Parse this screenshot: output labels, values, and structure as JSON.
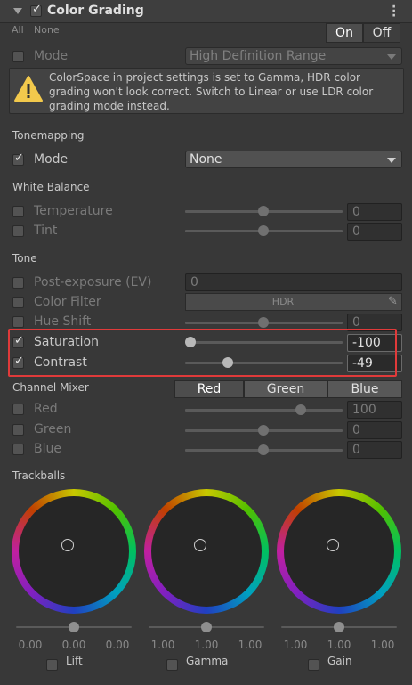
{
  "header": {
    "title": "Color Grading"
  },
  "top": {
    "all": "All",
    "none": "None",
    "on": "On",
    "off": "Off"
  },
  "mode_row": {
    "label": "Mode",
    "value": "High Definition Range"
  },
  "warning": {
    "text": "ColorSpace in project settings is set to Gamma, HDR color grading won't look correct. Switch to Linear or use LDR color grading mode instead."
  },
  "tonemapping": {
    "title": "Tonemapping",
    "mode_label": "Mode",
    "mode_value": "None"
  },
  "white_balance": {
    "title": "White Balance",
    "temperature": {
      "label": "Temperature",
      "value": "0",
      "position": 0.5
    },
    "tint": {
      "label": "Tint",
      "value": "0",
      "position": 0.5
    }
  },
  "tone": {
    "title": "Tone",
    "post_exposure": {
      "label": "Post-exposure (EV)",
      "value": "0"
    },
    "color_filter": {
      "label": "Color Filter",
      "value": "HDR"
    },
    "hue_shift": {
      "label": "Hue Shift",
      "value": "0",
      "position": 0.5
    },
    "saturation": {
      "label": "Saturation",
      "value": "-100",
      "position": 0.0
    },
    "contrast": {
      "label": "Contrast",
      "value": "-49",
      "position": 0.25
    }
  },
  "channel_mixer": {
    "title": "Channel Mixer",
    "tabs": [
      "Red",
      "Green",
      "Blue"
    ],
    "red": {
      "label": "Red",
      "value": "100",
      "position": 0.75
    },
    "green": {
      "label": "Green",
      "value": "0",
      "position": 0.5
    },
    "blue": {
      "label": "Blue",
      "value": "0",
      "position": 0.5
    }
  },
  "trackballs": {
    "title": "Trackballs",
    "items": [
      {
        "label": "Lift",
        "values": [
          "0.00",
          "0.00",
          "0.00"
        ]
      },
      {
        "label": "Gamma",
        "values": [
          "1.00",
          "1.00",
          "1.00"
        ]
      },
      {
        "label": "Gain",
        "values": [
          "1.00",
          "1.00",
          "1.00"
        ]
      }
    ]
  },
  "colors": {
    "accent": "#e03a3a",
    "bg": "#383838"
  }
}
